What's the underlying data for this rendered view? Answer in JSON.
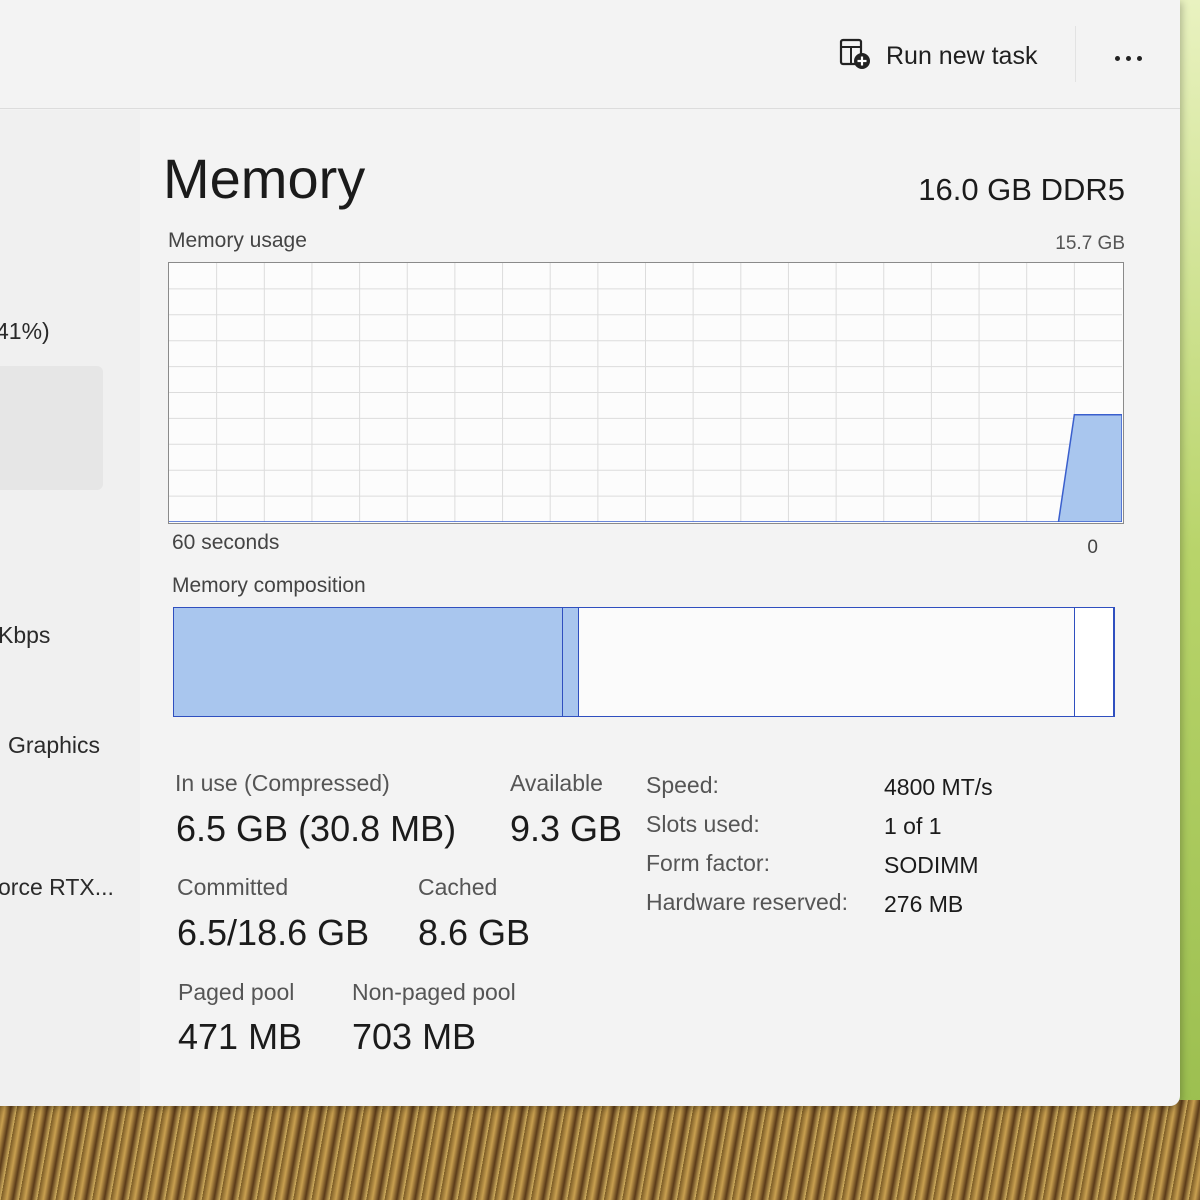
{
  "colors": {
    "graph_fill": "#a9c6ee",
    "graph_line": "#3a5fcd",
    "grid": "#dcdcdc",
    "composition_border": "#2f4fbf",
    "in_use_fill": "#a9c6ee"
  },
  "toolbar": {
    "run_new_task_label": "Run new task",
    "run_new_task_icon": "run-task-icon",
    "more_icon": "more-options-icon"
  },
  "sidebar": {
    "items": [
      {
        "label": "41%)"
      },
      {
        "label": "Kbps"
      },
      {
        "label": "Graphics"
      },
      {
        "label": "orce RTX..."
      }
    ]
  },
  "header": {
    "title": "Memory",
    "spec": "16.0 GB DDR5"
  },
  "usage_chart": {
    "label": "Memory usage",
    "max_label": "15.7 GB",
    "x_left_label": "60 seconds",
    "x_right_label": "0",
    "grid": true,
    "history_gb": [
      0,
      0,
      0,
      0,
      0,
      0,
      0,
      0,
      0,
      0,
      0,
      0,
      0,
      0,
      0,
      0,
      0,
      0,
      0,
      0,
      0,
      0,
      0,
      0,
      0,
      0,
      0,
      0,
      0,
      0,
      0,
      0,
      0,
      0,
      0,
      0,
      0,
      0,
      0,
      0,
      0,
      0,
      0,
      0,
      0,
      0,
      0,
      0,
      0,
      0,
      0,
      0,
      0,
      0,
      0,
      0,
      0,
      6.5,
      6.5,
      6.5,
      6.5
    ],
    "max_gb": 15.7
  },
  "composition": {
    "label": "Memory composition",
    "in_use_fraction": 0.414,
    "modified_fraction": 0.017,
    "standby_fraction": 0.527,
    "free_fraction": 0.042
  },
  "stats": {
    "in_use_label": "In use (Compressed)",
    "in_use_value": "6.5 GB (30.8 MB)",
    "available_label": "Available",
    "available_value": "9.3 GB",
    "committed_label": "Committed",
    "committed_value": "6.5/18.6 GB",
    "cached_label": "Cached",
    "cached_value": "8.6 GB",
    "paged_pool_label": "Paged pool",
    "paged_pool_value": "471 MB",
    "non_paged_pool_label": "Non-paged pool",
    "non_paged_pool_value": "703 MB"
  },
  "specs": {
    "speed_label": "Speed:",
    "speed_value": "4800 MT/s",
    "slots_label": "Slots used:",
    "slots_value": "1 of 1",
    "form_label": "Form factor:",
    "form_value": "SODIMM",
    "hw_label": "Hardware reserved:",
    "hw_value": "276 MB"
  }
}
